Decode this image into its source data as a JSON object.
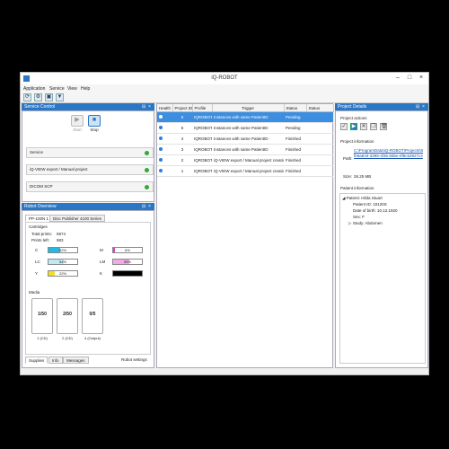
{
  "window": {
    "title": "iQ-ROBOT"
  },
  "menu": [
    "Application",
    "Service",
    "View",
    "Help"
  ],
  "service_control": {
    "title": "Service Control",
    "start_label": "Start",
    "stop_label": "Stop",
    "rows": [
      {
        "label": "Service",
        "status_color": "#33aa33"
      },
      {
        "label": "iQ-VIEW export / Manual project",
        "status_color": "#33aa33"
      },
      {
        "label": "DICOM SCP",
        "status_color": "#33aa33"
      }
    ]
  },
  "robot_overview": {
    "title": "Robot Overview",
    "device_tabs": [
      "PP-100N 1",
      "Disc Publisher 4100 Series"
    ],
    "cartridges_title": "Cartridges",
    "total_prints_label": "Total prints:",
    "total_prints": "5974",
    "prints_left_label": "Prints left:",
    "prints_left": "983",
    "cartridges": [
      {
        "name": "C",
        "percent": 42,
        "label": "42%",
        "color": "#22b8e0"
      },
      {
        "name": "M",
        "percent": 6,
        "label": "6%",
        "color": "#e040c0"
      },
      {
        "name": "LC",
        "percent": 54,
        "label": "54%",
        "color": "#bfe9f7"
      },
      {
        "name": "LM",
        "percent": 55,
        "label": "55%",
        "color": "#f5a8e8"
      },
      {
        "name": "Y",
        "percent": 22,
        "label": "22%",
        "color": "#f0e020"
      },
      {
        "name": "K",
        "percent": 100,
        "label": "",
        "color": "#000000"
      }
    ],
    "media_title": "Media",
    "media": [
      {
        "count": "1/50",
        "label": "1 (CD)"
      },
      {
        "count": "2/50",
        "label": "2 (CD)"
      },
      {
        "count": "0/5",
        "label": "4 (Output)"
      }
    ],
    "bottom_tabs": [
      "Supplies",
      "Info",
      "Messages"
    ],
    "robot_settings_label": "Robot settings"
  },
  "projects_table": {
    "columns": [
      "Health",
      "Project ID",
      "Profile",
      "Trigger",
      "Status",
      "Status"
    ],
    "rows": [
      {
        "id": "6",
        "profile": "IQROBOT",
        "trigger": "Instances with same PatientID",
        "status": "Pending",
        "selected": true
      },
      {
        "id": "5",
        "profile": "IQROBOT",
        "trigger": "Instances with same PatientID",
        "status": "Pending",
        "selected": false
      },
      {
        "id": "4",
        "profile": "IQROBOT",
        "trigger": "Instances with same PatientID",
        "status": "Finished",
        "selected": false
      },
      {
        "id": "3",
        "profile": "IQROBOT",
        "trigger": "Instances with same PatientID",
        "status": "Finished",
        "selected": false
      },
      {
        "id": "2",
        "profile": "IQROBOT",
        "trigger": "iQ-VIEW export / Manual project creation",
        "status": "Finished",
        "selected": false
      },
      {
        "id": "1",
        "profile": "IQROBOT",
        "trigger": "iQ-VIEW export / Manual project creation",
        "status": "Finished",
        "selected": false
      }
    ]
  },
  "project_details": {
    "title": "Project Details",
    "actions_title": "Project actions",
    "info_title": "Project information",
    "path_label": "Path:",
    "path_value": "C:\\ProgramData\\iQ-ROBOT\\Projects\\8fb9a819-3399-4f3b-b8be-0f8c53927c4",
    "size_label": "Size:",
    "size_value": "26.25 MB",
    "patient_title": "Patient information",
    "patient": {
      "root": "Patient: Hilda Stuart",
      "lines": [
        "Patient ID: 10120S",
        "Date of birth: 10.12.1920",
        "Sex: F"
      ],
      "study": "Study: Abdomen"
    }
  }
}
